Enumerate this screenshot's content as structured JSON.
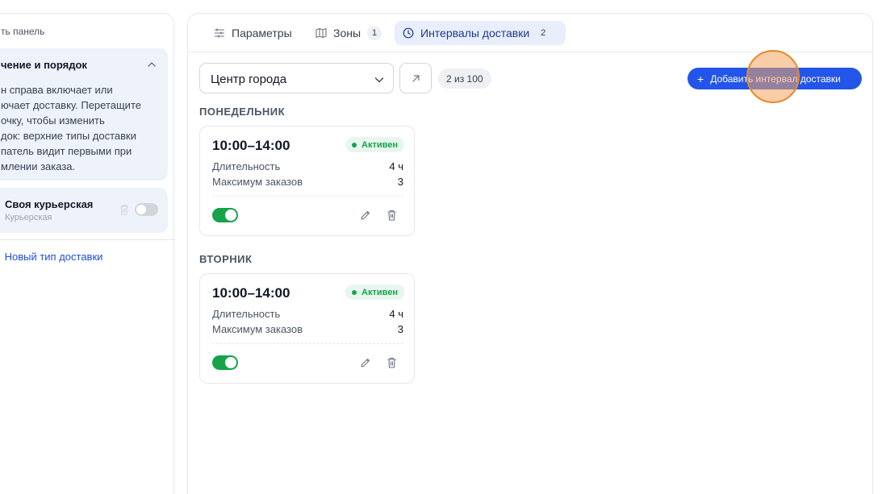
{
  "sidebar": {
    "hide_link": "ть панель",
    "info": {
      "title": "чение и порядок",
      "text": "н справа включает или\nючает доставку. Перетащите\nочку, чтобы изменить\nдок: верхние типы доставки\nпатель видит первыми при\nмлении заказа."
    },
    "courier": {
      "name": "Своя курьерская",
      "subtitle": "Курьерская",
      "enabled": false
    },
    "new_type": {
      "plus": "+",
      "label": "Новый тип доставки"
    }
  },
  "tabs": [
    {
      "label": "Параметры",
      "icon": "sliders-icon"
    },
    {
      "label": "Зоны",
      "count": "1",
      "icon": "map-icon"
    },
    {
      "label": "Интервалы доставки",
      "count": "2",
      "icon": "clock-icon",
      "active": true
    }
  ],
  "toolbar": {
    "city_value": "Центр города",
    "range_badge": "2 из 100",
    "add_plus": "+",
    "add_button": "Добавить интервал доставки"
  },
  "days": [
    {
      "label": "ПОНЕДЕЛЬНИК",
      "card": {
        "time": "10:00–14:00",
        "status": "Активен",
        "duration_label": "Длительность",
        "duration_value": "4 ч",
        "max_label": "Максимум заказов",
        "max_value": "3",
        "enabled": true
      }
    },
    {
      "label": "ВТОРНИК",
      "card": {
        "time": "10:00–14:00",
        "status": "Активен",
        "duration_label": "Длительность",
        "duration_value": "4 ч",
        "max_label": "Максимум заказов",
        "max_value": "3",
        "enabled": true
      }
    }
  ],
  "colors": {
    "accent": "#2255e8",
    "active_green": "#16a34a",
    "info_bg": "#eef2fb"
  }
}
